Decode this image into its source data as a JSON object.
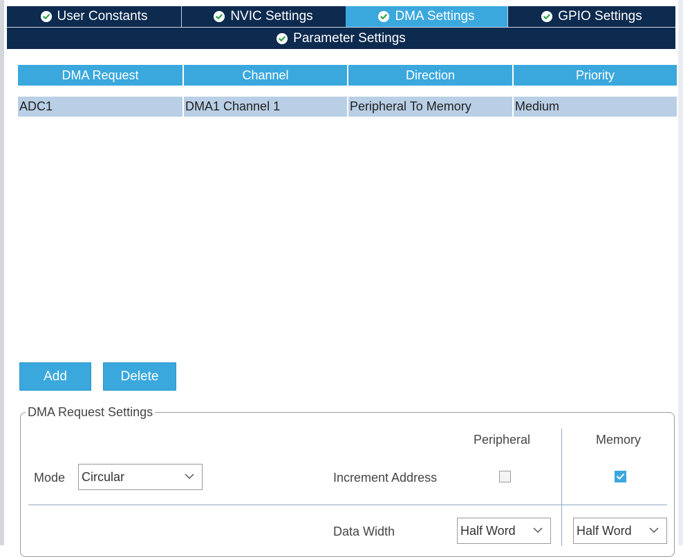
{
  "tabs": [
    {
      "label": "User Constants",
      "active": false
    },
    {
      "label": "NVIC Settings",
      "active": false
    },
    {
      "label": "DMA Settings",
      "active": true
    },
    {
      "label": "GPIO Settings",
      "active": false
    },
    {
      "label": "Parameter Settings",
      "active": false
    }
  ],
  "table": {
    "headers": [
      "DMA Request",
      "Channel",
      "Direction",
      "Priority"
    ],
    "rows": [
      [
        "ADC1",
        "DMA1 Channel 1",
        "Peripheral To Memory",
        "Medium"
      ]
    ]
  },
  "buttons": {
    "add": "Add",
    "delete": "Delete"
  },
  "settings": {
    "title": "DMA Request Settings",
    "peripheral_label": "Peripheral",
    "memory_label": "Memory",
    "mode_label": "Mode",
    "mode_value": "Circular",
    "increment_label": "Increment Address",
    "increment_peripheral": false,
    "increment_memory": true,
    "data_width_label": "Data Width",
    "data_width_peripheral": "Half Word",
    "data_width_memory": "Half Word"
  },
  "colors": {
    "tab_bg": "#0d2a4f",
    "accent": "#3aa8dd",
    "row_bg": "#b9cfe5"
  },
  "icons": {
    "tab_status": "check-circle-icon",
    "dropdown": "chevron-down-icon"
  }
}
